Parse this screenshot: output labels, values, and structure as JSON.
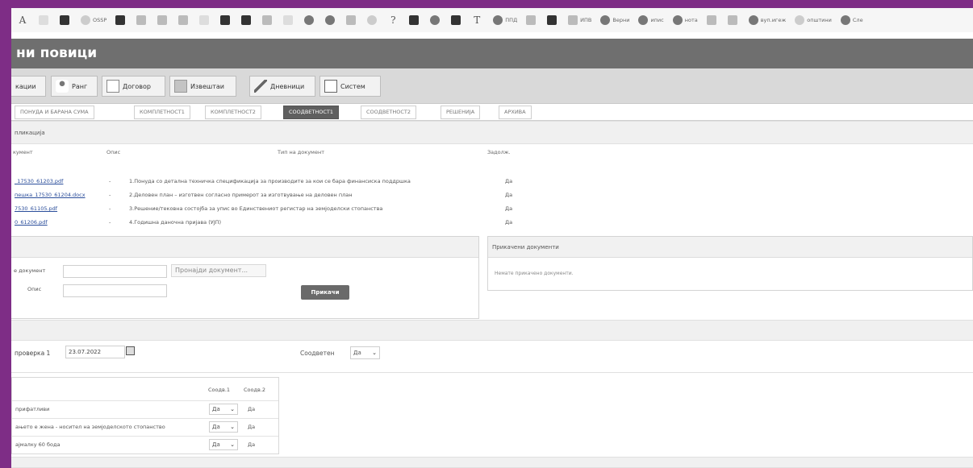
{
  "bookmarks": [
    {
      "icon": "letter-a-icon",
      "label": ""
    },
    {
      "icon": "document-icon",
      "label": ""
    },
    {
      "icon": "dark-square-icon",
      "label": ""
    },
    {
      "icon": "circle-icon",
      "label": "OSSP"
    },
    {
      "icon": "checkbox-icon",
      "label": ""
    },
    {
      "icon": "link-icon",
      "label": ""
    },
    {
      "icon": "grid-icon",
      "label": ""
    },
    {
      "icon": "grid-icon",
      "label": ""
    },
    {
      "icon": "bars-icon",
      "label": ""
    },
    {
      "icon": "mail-icon",
      "label": ""
    },
    {
      "icon": "edit-icon",
      "label": ""
    },
    {
      "icon": "sheet-icon",
      "label": ""
    },
    {
      "icon": "wave-icon",
      "label": ""
    },
    {
      "icon": "settings-icon",
      "label": ""
    },
    {
      "icon": "gear-icon",
      "label": ""
    },
    {
      "icon": "table-icon",
      "label": ""
    },
    {
      "icon": "refresh-icon",
      "label": ""
    },
    {
      "icon": "question-icon",
      "label": ""
    },
    {
      "icon": "app-icon",
      "label": ""
    },
    {
      "icon": "pinterest-icon",
      "label": ""
    },
    {
      "icon": "square-icon",
      "label": ""
    },
    {
      "icon": "letter-t-icon",
      "label": ""
    },
    {
      "icon": "globe-icon",
      "label": "ППД"
    },
    {
      "icon": "people-icon",
      "label": ""
    },
    {
      "icon": "calendar-icon",
      "label": ""
    },
    {
      "icon": "grid-icon",
      "label": "ИПВ"
    },
    {
      "icon": "globe-icon",
      "label": "Верни"
    },
    {
      "icon": "globe-icon",
      "label": "ипис"
    },
    {
      "icon": "drop-icon",
      "label": "нота"
    },
    {
      "icon": "antenna-icon",
      "label": ""
    },
    {
      "icon": "drive-icon",
      "label": ""
    },
    {
      "icon": "circle-icon",
      "label": "вуп.игеж"
    },
    {
      "icon": "leaf-icon",
      "label": "општини"
    },
    {
      "icon": "globe-icon",
      "label": "Сле"
    }
  ],
  "app": {
    "title": "ни повици"
  },
  "toolbar": [
    {
      "label": "кации",
      "icon": ""
    },
    {
      "label": "Ранг",
      "icon": "people-icon"
    },
    {
      "label": "Договор",
      "icon": "contract-icon"
    },
    {
      "label": "Извештаи",
      "icon": "folder-icon"
    },
    {
      "label": "Дневници",
      "icon": "pen-icon"
    },
    {
      "label": "Систем",
      "icon": "checkbox-icon"
    }
  ],
  "tabs": [
    {
      "label": "ПОНУДА И БАРАНА СУМА",
      "active": false
    },
    {
      "label": "КОМПЛЕТНОСТ1",
      "active": false
    },
    {
      "label": "КОМПЛЕТНОСТ2",
      "active": false
    },
    {
      "label": "СООДВЕТНОСТ1",
      "active": true
    },
    {
      "label": "СООДВЕТНОСТ2",
      "active": false
    },
    {
      "label": "РЕШЕНИЈА",
      "active": false
    },
    {
      "label": "АРХИВА",
      "active": false
    }
  ],
  "application_section": {
    "label": "пликација"
  },
  "documents": {
    "headers": {
      "document": "кумент",
      "description": "Опис",
      "doc_type": "Тип на документ",
      "mandatory": "Задолж."
    },
    "rows": [
      {
        "file": "_17530_61203.pdf",
        "description": "-",
        "type": "1.Понуда со детална техничка спецификација за производите за кои се бара финансиска поддршка",
        "mandatory": "Да"
      },
      {
        "file": "пешка_17530_61204.docx",
        "description": "-",
        "type": "2.Деловен план – изготвен согласно примерот за изготвување на деловен план",
        "mandatory": "Да"
      },
      {
        "file": "7530_61105.pdf",
        "description": "-",
        "type": "3.Решение/тековна состојба за упис во Единствениот регистар на земјоделски стопанства",
        "mandatory": "Да"
      },
      {
        "file": "0_61206.pdf",
        "description": "-",
        "type": "4.Годишна даночна пријава (УЈП)",
        "mandatory": "Да"
      }
    ]
  },
  "upload": {
    "doc_label": "е документ",
    "desc_label": "Опис",
    "find_button": "Пронајди документ...",
    "attach_button": "Прикачи"
  },
  "attached": {
    "title": "Прикачени документи",
    "empty_text": "Немате прикачено документи."
  },
  "check": {
    "label": "проверка 1",
    "date": "23.07.2022",
    "matches_label": "Соодветен",
    "matches_value": "Да"
  },
  "criteria": {
    "col1": "Соодв.1",
    "col2": "Соодв.2",
    "rows": [
      {
        "text": "прифатливи",
        "v1": "Да",
        "v2": "Да"
      },
      {
        "text": "ањето е жена - носител на земјоделското стопанство",
        "v1": "Да",
        "v2": "Да"
      },
      {
        "text": "ајмалку 60 бода",
        "v1": "Да",
        "v2": "Да"
      }
    ]
  }
}
